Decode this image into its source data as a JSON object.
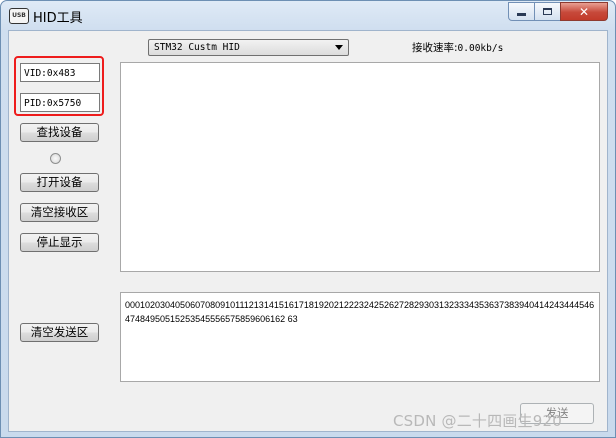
{
  "window": {
    "title": "HID工具",
    "icon_label": "USB",
    "controls": {
      "minimize": "minimize-icon",
      "maximize": "maximize-icon",
      "close": "close-icon"
    }
  },
  "device": {
    "vid": "VID:0x483",
    "pid": "PID:0x5750",
    "selected": "STM32 Custm HID"
  },
  "receive_rate": {
    "label": "接收速率:",
    "value": "0.00kb/s"
  },
  "buttons": {
    "find": "查找设备",
    "open": "打开设备",
    "clear_receive": "清空接收区",
    "stop_display": "停止显示",
    "clear_send": "清空发送区",
    "send": "发送"
  },
  "send_area": {
    "text": "000102030405060708091011121314151617181920212223242526272829303132333435363738394041424344454647484950515253545556575859606162 63"
  },
  "watermark": "CSDN @二十四画生920",
  "colors": {
    "highlight": "#ee1c1c",
    "title_bar": "#cfdeef",
    "close_button": "#c7493a"
  }
}
